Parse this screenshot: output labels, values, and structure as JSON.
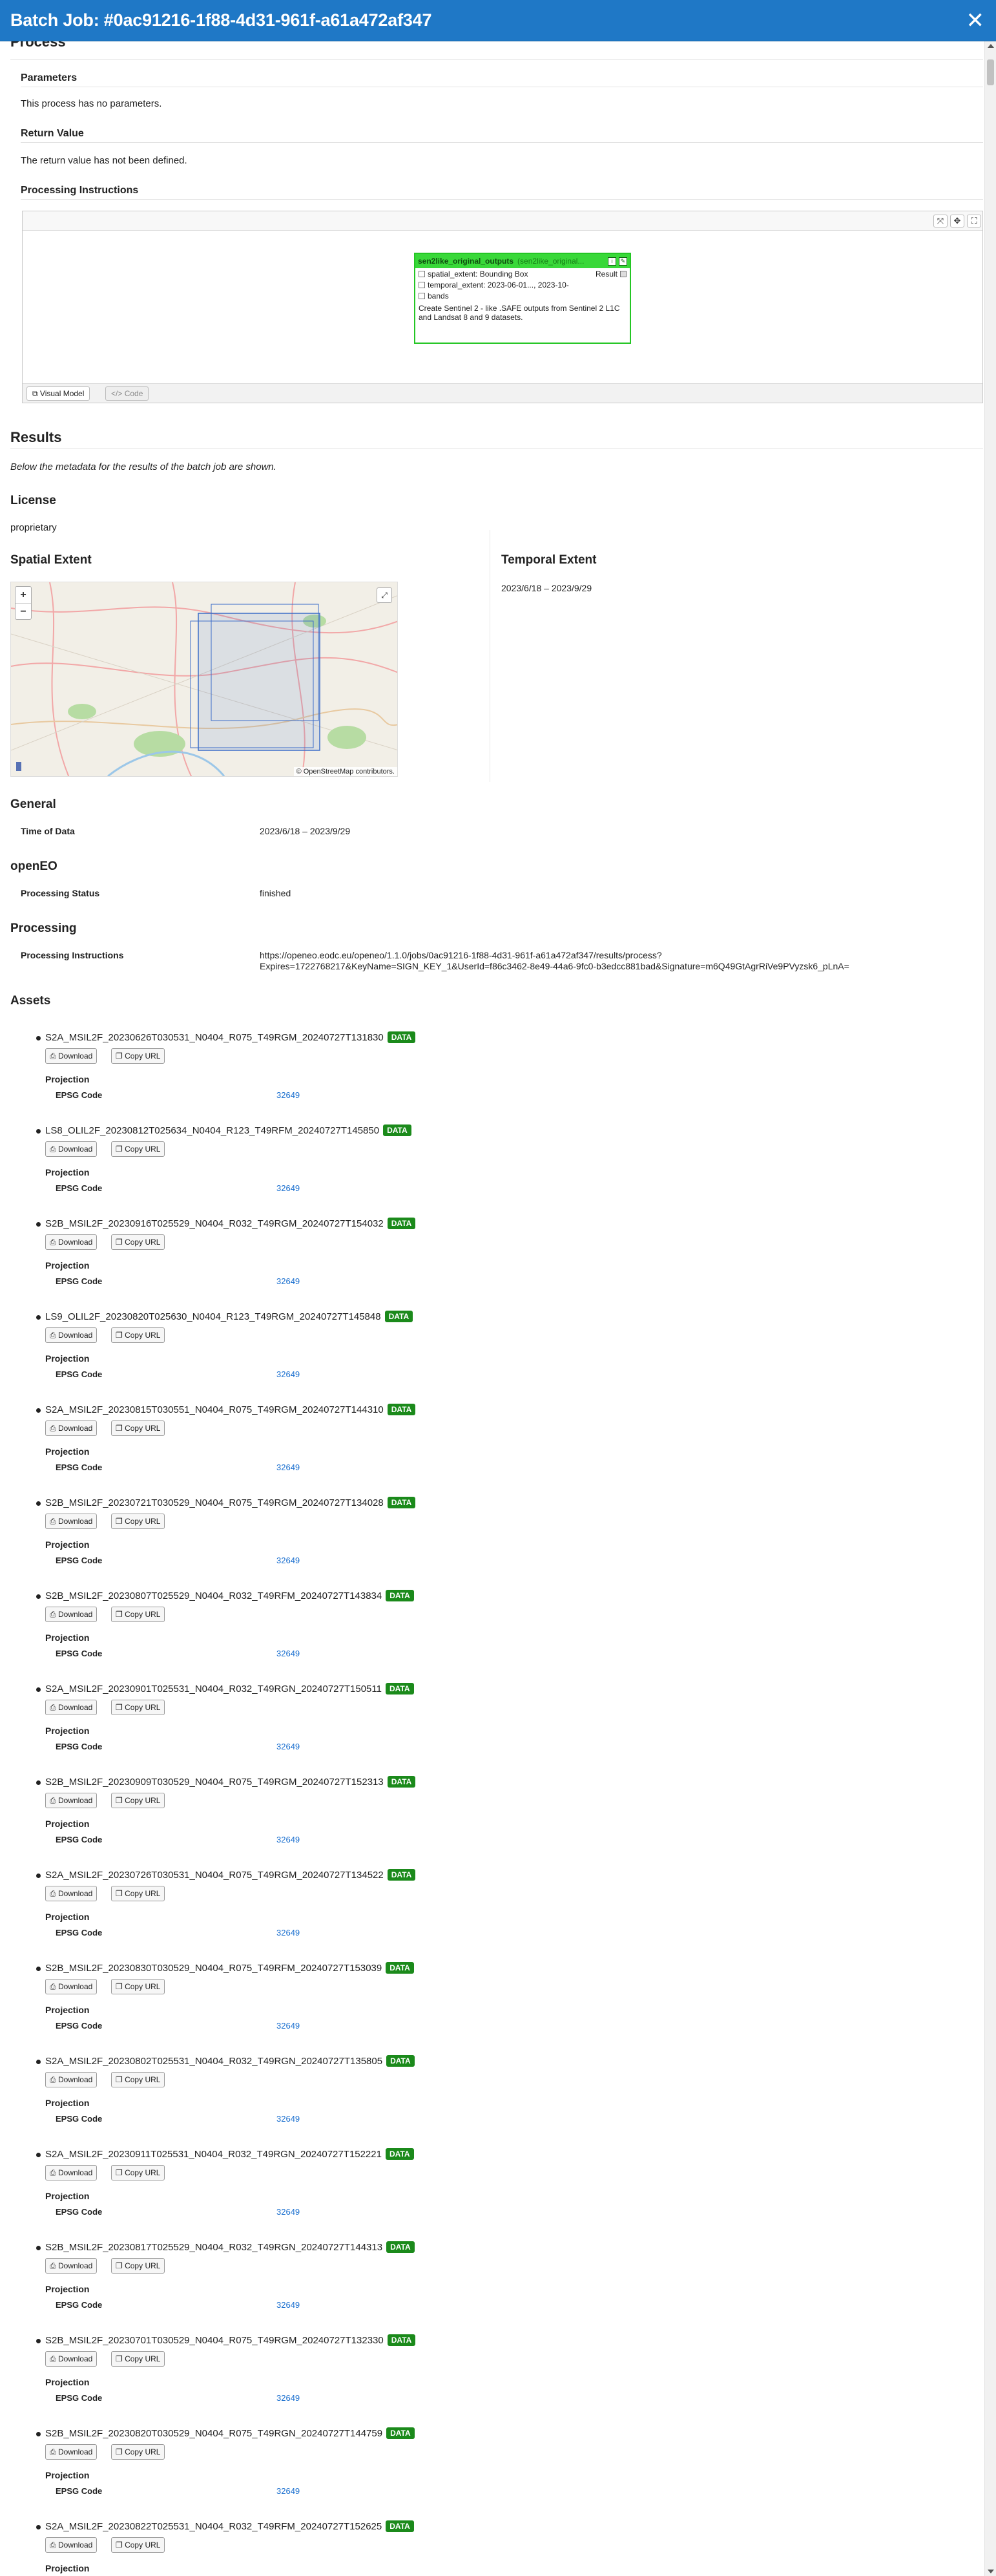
{
  "header": {
    "title": "Batch Job: #0ac91216-1f88-4d31-961f-a61a472af347",
    "close_glyph": "✕"
  },
  "process": {
    "heading": "Process",
    "parameters_heading": "Parameters",
    "parameters_text": "This process has no parameters.",
    "return_heading": "Return Value",
    "return_text": "The return value has not been defined.",
    "instructions_heading": "Processing Instructions"
  },
  "editor": {
    "node_title": "sen2like_original_outputs",
    "node_subtitle": "(sen2like_original...",
    "node_params": [
      "spatial_extent: Bounding Box",
      "temporal_extent: 2023-06-01..., 2023-10-",
      "bands"
    ],
    "node_result_label": "Result",
    "node_description": "Create Sentinel 2 - like .SAFE outputs from Sentinel 2 L1C and Landsat 8 and 9 datasets.",
    "tabs": [
      "Visual Model",
      "Code"
    ]
  },
  "results": {
    "heading": "Results",
    "intro": "Below the metadata for the results of the batch job are shown.",
    "license_heading": "License",
    "license_value": "proprietary",
    "spatial_heading": "Spatial Extent",
    "temporal_heading": "Temporal Extent",
    "temporal_value": "2023/6/18 – 2023/9/29",
    "map_attribution": "© OpenStreetMap contributors."
  },
  "general": {
    "heading": "General",
    "time_label": "Time of Data",
    "time_value": "2023/6/18 – 2023/9/29"
  },
  "openeo": {
    "heading": "openEO",
    "status_label": "Processing Status",
    "status_value": "finished"
  },
  "processing": {
    "heading": "Processing",
    "instr_label": "Processing Instructions",
    "instr_line1": "https://openeo.eodc.eu/openeo/1.1.0/jobs/0ac91216-1f88-4d31-961f-a61a472af347/results/process?",
    "instr_line2": "Expires=1722768217&KeyName=SIGN_KEY_1&UserId=f86c3462-8e49-44a6-9fc0-b3edcc881bad&Signature=m6Q49GtAgrRiVe9PVyzsk6_pLnA="
  },
  "assets": {
    "heading": "Assets",
    "badge": "DATA",
    "download_label": "Download",
    "copy_label": "Copy URL",
    "projection_label": "Projection",
    "epsg_label": "EPSG Code",
    "epsg_value": "32649",
    "items": [
      "S2A_MSIL2F_20230626T030531_N0404_R075_T49RGM_20240727T131830",
      "LS8_OLIL2F_20230812T025634_N0404_R123_T49RFM_20240727T145850",
      "S2B_MSIL2F_20230916T025529_N0404_R032_T49RGM_20240727T154032",
      "LS9_OLIL2F_20230820T025630_N0404_R123_T49RGM_20240727T145848",
      "S2A_MSIL2F_20230815T030551_N0404_R075_T49RGM_20240727T144310",
      "S2B_MSIL2F_20230721T030529_N0404_R075_T49RGM_20240727T134028",
      "S2B_MSIL2F_20230807T025529_N0404_R032_T49RFM_20240727T143834",
      "S2A_MSIL2F_20230901T025531_N0404_R032_T49RGN_20240727T150511",
      "S2B_MSIL2F_20230909T030529_N0404_R075_T49RGM_20240727T152313",
      "S2A_MSIL2F_20230726T030531_N0404_R075_T49RGM_20240727T134522",
      "S2B_MSIL2F_20230830T030529_N0404_R075_T49RFM_20240727T153039",
      "S2A_MSIL2F_20230802T025531_N0404_R032_T49RGN_20240727T135805",
      "S2A_MSIL2F_20230911T025531_N0404_R032_T49RGN_20240727T152221",
      "S2B_MSIL2F_20230817T025529_N0404_R032_T49RGN_20240727T144313",
      "S2B_MSIL2F_20230701T030529_N0404_R075_T49RGM_20240727T132330",
      "S2B_MSIL2F_20230820T030529_N0404_R075_T49RGN_20240727T144759",
      "S2A_MSIL2F_20230822T025531_N0404_R032_T49RFM_20240727T152625"
    ]
  }
}
